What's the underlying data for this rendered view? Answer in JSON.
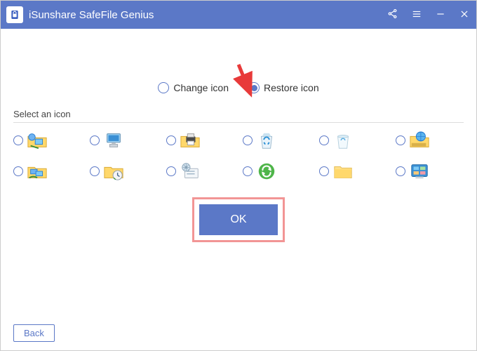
{
  "titlebar": {
    "app_name": "iSunshare SafeFile Genius"
  },
  "options": {
    "change_label": "Change icon",
    "restore_label": "Restore icon",
    "selected": "restore"
  },
  "section": {
    "label": "Select an icon"
  },
  "icons": [
    {
      "name": "network-folder-icon"
    },
    {
      "name": "this-pc-icon"
    },
    {
      "name": "printer-folder-icon"
    },
    {
      "name": "recycle-bin-full-icon"
    },
    {
      "name": "recycle-bin-empty-icon"
    },
    {
      "name": "network-drive-icon"
    },
    {
      "name": "shared-folder-icon"
    },
    {
      "name": "recent-folder-icon"
    },
    {
      "name": "system-settings-icon"
    },
    {
      "name": "sync-icon"
    },
    {
      "name": "plain-folder-icon"
    },
    {
      "name": "control-panel-icon"
    }
  ],
  "buttons": {
    "ok": "OK",
    "back": "Back"
  },
  "colors": {
    "accent": "#5b78c7",
    "highlight": "#f29595"
  }
}
